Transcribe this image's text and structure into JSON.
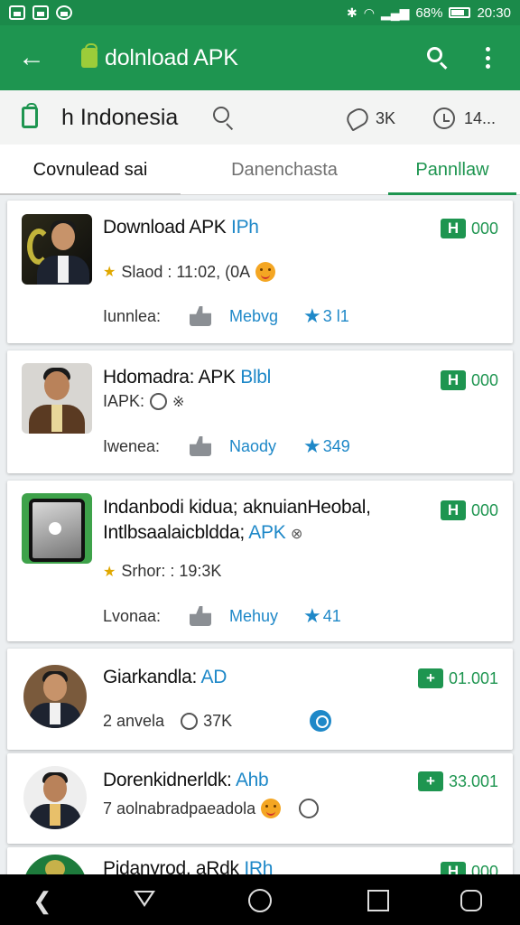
{
  "status_bar": {
    "battery": "68%",
    "time": "20:30"
  },
  "app_bar": {
    "title": "dolnload APK"
  },
  "location_bar": {
    "text": "h Indonesia",
    "comments": "3K",
    "count": "14..."
  },
  "tabs": [
    {
      "label": "Covnulead sai"
    },
    {
      "label": "Danenchasta"
    },
    {
      "label": "Pannllaw"
    }
  ],
  "cards": [
    {
      "title": "Download APK",
      "title_accent": "IPh",
      "sub": "Slaod : 11:02, (0A",
      "meta_label": "Iunnlea:",
      "meta_link": "Mebvg",
      "meta_rating": "3 l1",
      "counter": "000"
    },
    {
      "title": "Hdomadra: APK",
      "title_accent": "Blbl",
      "sub": "IAPK:",
      "meta_label": "Iwenea:",
      "meta_link": "Naody",
      "meta_rating": "349",
      "counter": "000"
    },
    {
      "title_line1": "Indanbodi kidua; aknuianHeobal,",
      "title_line2": "Intlbsaalaicbldda;",
      "title_accent": "APK",
      "sub": "Srhor: : 19:3K",
      "meta_label": "Lvonaa:",
      "meta_link": "Mehuy",
      "meta_rating": "41",
      "counter": "000"
    },
    {
      "title": "Giarkandla:",
      "title_accent": "AD",
      "sub": "2 anvela",
      "sub_extra": "37K",
      "counter": "01.001"
    },
    {
      "title": "Dorenkidnerldk:",
      "title_accent": "Ahb",
      "sub": "7 aolnabradpaeadola",
      "counter": "33.001"
    },
    {
      "title": "Pidanyrod. aRdk",
      "title_accent": "IRh",
      "counter": "000"
    }
  ]
}
